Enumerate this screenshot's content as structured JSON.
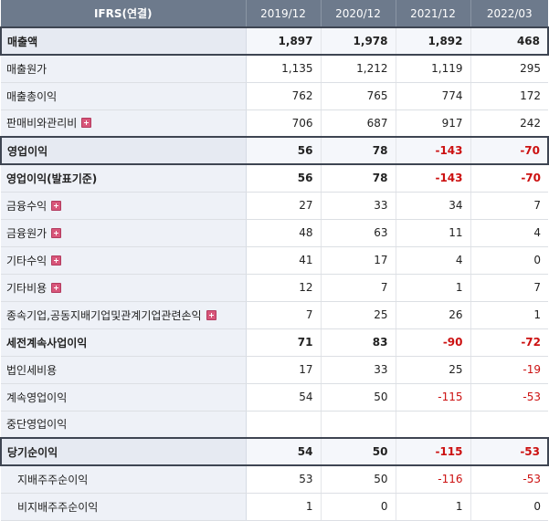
{
  "header": {
    "label": "IFRS(연결)",
    "periods": [
      "2019/12",
      "2020/12",
      "2021/12",
      "2022/03"
    ]
  },
  "rows": [
    {
      "label": "매출액",
      "values": [
        "1,897",
        "1,978",
        "1,892",
        "468"
      ]
    },
    {
      "label": "매출원가",
      "values": [
        "1,135",
        "1,212",
        "1,119",
        "295"
      ]
    },
    {
      "label": "매출총이익",
      "values": [
        "762",
        "765",
        "774",
        "172"
      ]
    },
    {
      "label": "판매비와관리비",
      "values": [
        "706",
        "687",
        "917",
        "242"
      ]
    },
    {
      "label": "영업이익",
      "values": [
        "56",
        "78",
        "-143",
        "-70"
      ]
    },
    {
      "label": "영업이익(발표기준)",
      "values": [
        "56",
        "78",
        "-143",
        "-70"
      ]
    },
    {
      "label": "금융수익",
      "values": [
        "27",
        "33",
        "34",
        "7"
      ]
    },
    {
      "label": "금융원가",
      "values": [
        "48",
        "63",
        "11",
        "4"
      ]
    },
    {
      "label": "기타수익",
      "values": [
        "41",
        "17",
        "4",
        "0"
      ]
    },
    {
      "label": "기타비용",
      "values": [
        "12",
        "7",
        "1",
        "7"
      ]
    },
    {
      "label": "종속기업,공동지배기업및관계기업관련손익",
      "values": [
        "7",
        "25",
        "26",
        "1"
      ]
    },
    {
      "label": "세전계속사업이익",
      "values": [
        "71",
        "83",
        "-90",
        "-72"
      ]
    },
    {
      "label": "법인세비용",
      "values": [
        "17",
        "33",
        "25",
        "-19"
      ]
    },
    {
      "label": "계속영업이익",
      "values": [
        "54",
        "50",
        "-115",
        "-53"
      ]
    },
    {
      "label": "중단영업이익",
      "values": [
        "",
        "",
        "",
        ""
      ]
    },
    {
      "label": "당기순이익",
      "values": [
        "54",
        "50",
        "-115",
        "-53"
      ]
    },
    {
      "label": "지배주주순이익",
      "values": [
        "53",
        "50",
        "-116",
        "-53"
      ]
    },
    {
      "label": "비지배주주순이익",
      "values": [
        "1",
        "0",
        "1",
        "0"
      ]
    }
  ],
  "expand_icon": "plus-icon",
  "colors": {
    "header_bg": "#6d7a8c",
    "label_bg": "#eef1f7",
    "negative": "#cc1111",
    "expand_icon": "#d8567a"
  }
}
